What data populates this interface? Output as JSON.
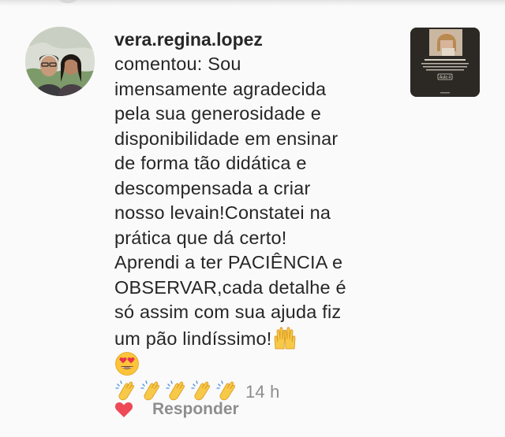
{
  "comment": {
    "username": "vera.regina.lopez",
    "text": "comentou: Sou\nimensamente agradecida\npela sua generosidade e\ndisponibilidade em ensinar\nde forma tão didática e\ndescompensada a criar\nnosso levain!Constatei na\nprática que dá certo!\nAprendi a ter PACIÊNCIA e\nOBSERVAR,cada detalhe é\nsó assim com sua ajuda fiz\num pão lindíssimo!",
    "emojis_line_end": [
      "raising-hands-emoji",
      "heart-eyes-emoji"
    ],
    "emojis_clapping": [
      "clapping-hands-emoji",
      "clapping-hands-emoji",
      "clapping-hands-emoji",
      "clapping-hands-emoji",
      "clapping-hands-emoji"
    ],
    "timestamp": "14 h"
  },
  "actions": {
    "like_icon": "heart-icon",
    "like_color": "#ed4956",
    "reply_label": "Responder"
  },
  "thumbnail": {
    "caption_badge": "Aula 4"
  },
  "colors": {
    "text": "#262626",
    "secondary": "#8e8e8e",
    "background": "#fafafa"
  }
}
